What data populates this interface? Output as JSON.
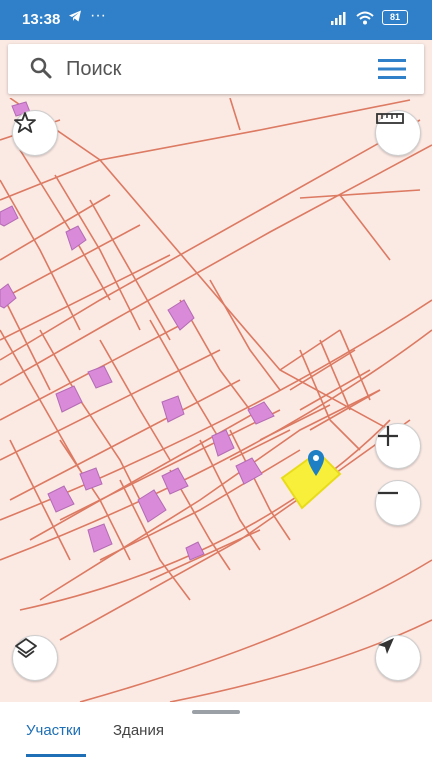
{
  "status_bar": {
    "time": "13:38",
    "battery": "81"
  },
  "search": {
    "placeholder": "Поиск"
  },
  "map": {
    "selected_parcel_color": "#f7ef3a",
    "parcel_line_color": "#dc7a62",
    "building_color": "#d98ad9",
    "marker_color": "#1e7fc4"
  },
  "map_controls": {
    "favorite": "star-icon",
    "ruler": "ruler-icon",
    "zoom_in": "plus-icon",
    "zoom_out": "minus-icon",
    "layers": "layers-icon",
    "my_location": "navigation-arrow-icon"
  },
  "bottom_tabs": [
    {
      "label": "Участки",
      "active": true
    },
    {
      "label": "Здания",
      "active": false
    }
  ]
}
